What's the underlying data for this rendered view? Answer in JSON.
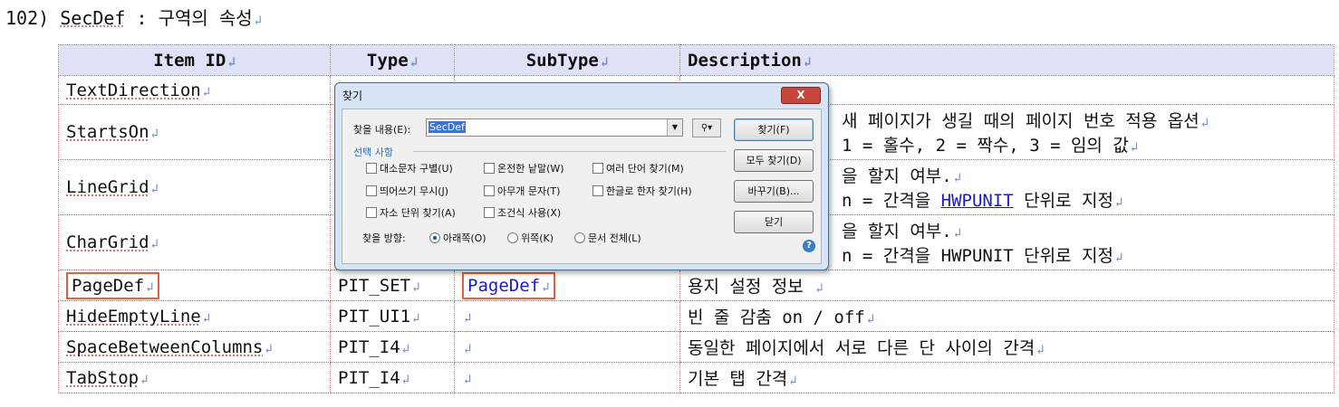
{
  "heading": {
    "number": "102)",
    "name": "SecDef",
    "separator": ":",
    "subtitle": "구역의 속성"
  },
  "pilcrow": "↲",
  "table": {
    "headers": [
      "Item ID",
      "Type",
      "SubType",
      "Description"
    ],
    "rows": [
      {
        "id": "TextDirection",
        "type": "",
        "subtype": "",
        "desc": [
          "",
          ""
        ]
      },
      {
        "id": "StartsOn",
        "type": "",
        "subtype": "",
        "desc": [
          "새 페이지가 생길 때의 페이지 번호 적용 옵션",
          "1 = 홀수, 2 = 짝수, 3 = 임의 값"
        ]
      },
      {
        "id": "LineGrid",
        "type": "",
        "subtype": "",
        "desc": [
          "을 할지 여부.",
          "n = 간격을 ",
          "HWPUNIT",
          " 단위로 지정"
        ]
      },
      {
        "id": "CharGrid",
        "type": "",
        "subtype": "",
        "desc": [
          "을 할지 여부.",
          "n = 간격을 HWPUNIT 단위로 지정"
        ]
      },
      {
        "id": "PageDef",
        "type": "PIT_SET",
        "subtype": "PageDef",
        "desc": [
          "용지 설정 정보"
        ]
      },
      {
        "id": "HideEmptyLine",
        "type": "PIT_UI1",
        "subtype": "",
        "desc": [
          "빈 줄 감춤 on / off"
        ]
      },
      {
        "id": "SpaceBetweenColumns",
        "type": "PIT_I4",
        "subtype": "",
        "desc": [
          "동일한 페이지에서 서로 다른 단 사이의 간격"
        ]
      },
      {
        "id": "TabStop",
        "type": "PIT_I4",
        "subtype": "",
        "desc": [
          "기본 탭 간격"
        ]
      }
    ]
  },
  "dialog": {
    "title": "찾기",
    "close_label": "X",
    "find_label": "찾을 내용(E):",
    "find_value": "SecDef",
    "options_title": "선택 사항",
    "options": [
      "대소문자 구별(U)",
      "온전한 낱말(W)",
      "여러 단어 찾기(M)",
      "띄어쓰기 무시(J)",
      "아무개 문자(T)",
      "한글로 한자 찾기(H)",
      "자소 단위 찾기(A)",
      "조건식 사용(X)"
    ],
    "direction_label": "찾을 방향:",
    "directions": [
      "아래쪽(O)",
      "위쪽(K)",
      "문서 전체(L)"
    ],
    "buttons": {
      "find": "찾기(F)",
      "find_all": "모두 찾기(D)",
      "replace": "바꾸기(B)...",
      "close": "닫기"
    },
    "help": "?"
  }
}
